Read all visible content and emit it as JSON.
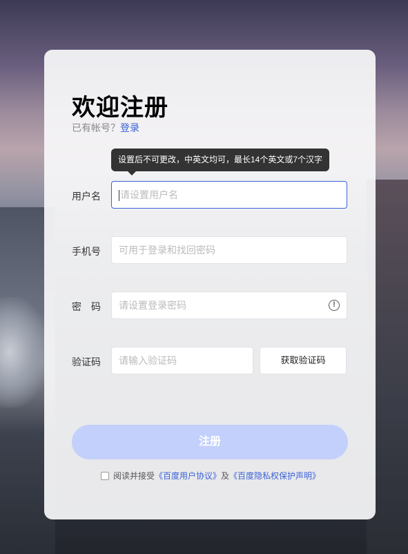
{
  "title": "欢迎注册",
  "login_prompt": {
    "text": "已有帐号？",
    "link": "登录"
  },
  "tooltip": "设置后不可更改，中英文均可，最长14个英文或7个汉字",
  "fields": {
    "username": {
      "label": "用户名",
      "placeholder": "请设置用户名"
    },
    "phone": {
      "label": "手机号",
      "placeholder": "可用于登录和找回密码"
    },
    "password": {
      "label": "密　码",
      "placeholder": "请设置登录密码"
    },
    "code": {
      "label": "验证码",
      "placeholder": "请输入验证码"
    }
  },
  "get_code_button": "获取验证码",
  "submit_button": "注册",
  "agreement": {
    "prefix": "阅读并接受",
    "user_agreement": "《百度用户协议》",
    "and": "及",
    "privacy": "《百度隐私权保护声明》"
  },
  "colors": {
    "link": "#3b62d8",
    "submit_bg": "#c3d0fb"
  }
}
